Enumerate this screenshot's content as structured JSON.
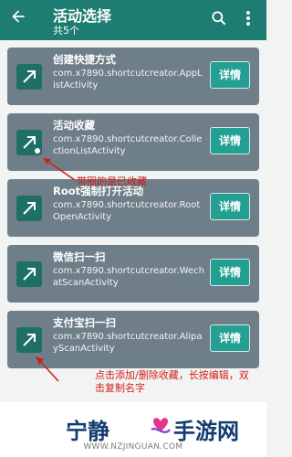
{
  "appbar": {
    "title": "活动选择",
    "subtitle": "共5个"
  },
  "activities": [
    {
      "name": "创建快捷方式",
      "package": "com.x7890.shortcutcreator.AppListActivity",
      "button": "详情",
      "collected": false
    },
    {
      "name": "活动收藏",
      "package": "com.x7890.shortcutcreator.CollectionListActivity",
      "button": "详情",
      "collected": true
    },
    {
      "name": "Root强制打开活动",
      "package": "com.x7890.shortcutcreator.RootOpenActivity",
      "button": "详情",
      "collected": false
    },
    {
      "name": "微信扫一扫",
      "package": "com.x7890.shortcutcreator.WechatScanActivity",
      "button": "详情",
      "collected": false
    },
    {
      "name": "支付宝扫一扫",
      "package": "com.x7890.shortcutcreator.AlipayScanActivity",
      "button": "详情",
      "collected": false
    }
  ],
  "annotations": {
    "collected_note": "带圈的是已收藏",
    "usage_note": "点击添加/删除收藏，长按编辑，双击复制名字"
  },
  "watermark": {
    "brand_left": "宁静",
    "brand_right": "手游网",
    "url": "WWW.NZJINGUAN.COM"
  },
  "colors": {
    "appbar": "#1e7d72",
    "card": "#6f7f89",
    "button": "#23a093",
    "annotation": "#d21f17"
  }
}
